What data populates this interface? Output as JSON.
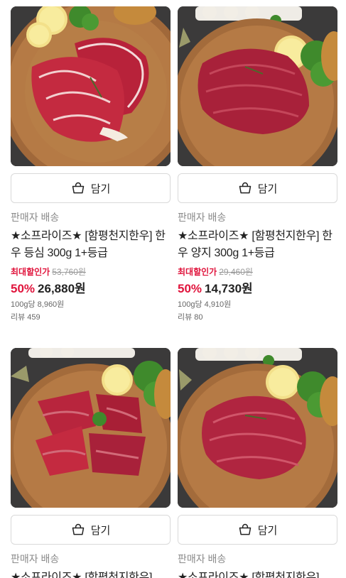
{
  "products": [
    {
      "image_alt": "sliced marbled ribeye steak on wooden board",
      "cart_label": "담기",
      "seller": "판매자 배송",
      "title": "★소프라이즈★ [함평천지한우] 한우 등심 300g 1+등급",
      "max_discount_label": "최대할인가",
      "original_price": "53,760원",
      "discount_pct": "50%",
      "final_price": "26,880원",
      "per_100g": "100g당 8,960원",
      "reviews": "리뷰 459"
    },
    {
      "image_alt": "beef brisket block on wooden board",
      "cart_label": "담기",
      "seller": "판매자 배송",
      "title": "★소프라이즈★ [함평천지한우] 한우 양지 300g 1+등급",
      "max_discount_label": "최대할인가",
      "original_price": "29,460원",
      "discount_pct": "50%",
      "final_price": "14,730원",
      "per_100g": "100g당 4,910원",
      "reviews": "리뷰 80"
    },
    {
      "image_alt": "cubed beef chunks on wooden board",
      "cart_label": "담기",
      "seller": "판매자 배송",
      "title": "★소프라이즈★ [함평천지한우]"
    },
    {
      "image_alt": "beef block on wooden board",
      "cart_label": "담기",
      "seller": "판매자 배송",
      "title": "★소프라이즈★ [함평천지한우]"
    }
  ],
  "colors": {
    "accent": "#e0143c",
    "muted": "#8a8a8a",
    "text": "#222222",
    "border": "#d9d9d9"
  }
}
